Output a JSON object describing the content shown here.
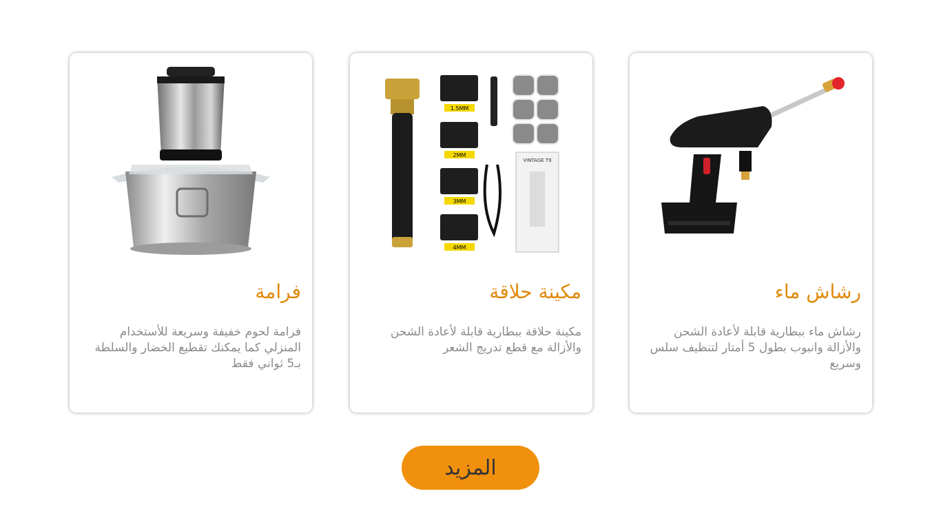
{
  "products": [
    {
      "title": "فرامة",
      "description": "فرامة لحوم خفيفة وسريعة للأستخدام المنزلي كما يمكنك تقطيع الخضار والسلطة بـ5 ثواني فقط",
      "image": "meat-grinder-image"
    },
    {
      "title": "مكينة حلاقة",
      "description": "مكينة حلاقة ببطارية قابلة لأعادة الشحن والأزالة مع قطع تدريج الشعر",
      "image": "hair-clipper-image",
      "guard_labels": [
        "1.5MM",
        "2MM",
        "3MM",
        "4MM"
      ],
      "box_label": "VINTAGE T9"
    },
    {
      "title": "رشاش ماء",
      "description": "رشاش ماء ببطارية قابلة لأعادة الشحن والأزالة وانبوب بطول 5 أمتار لتنظيف سلس وسريع",
      "image": "water-sprayer-image"
    }
  ],
  "more_button": {
    "label": "المزيد"
  },
  "colors": {
    "accent": "#f0900c",
    "title": "#e08a0b",
    "text": "#8a8a8a"
  }
}
